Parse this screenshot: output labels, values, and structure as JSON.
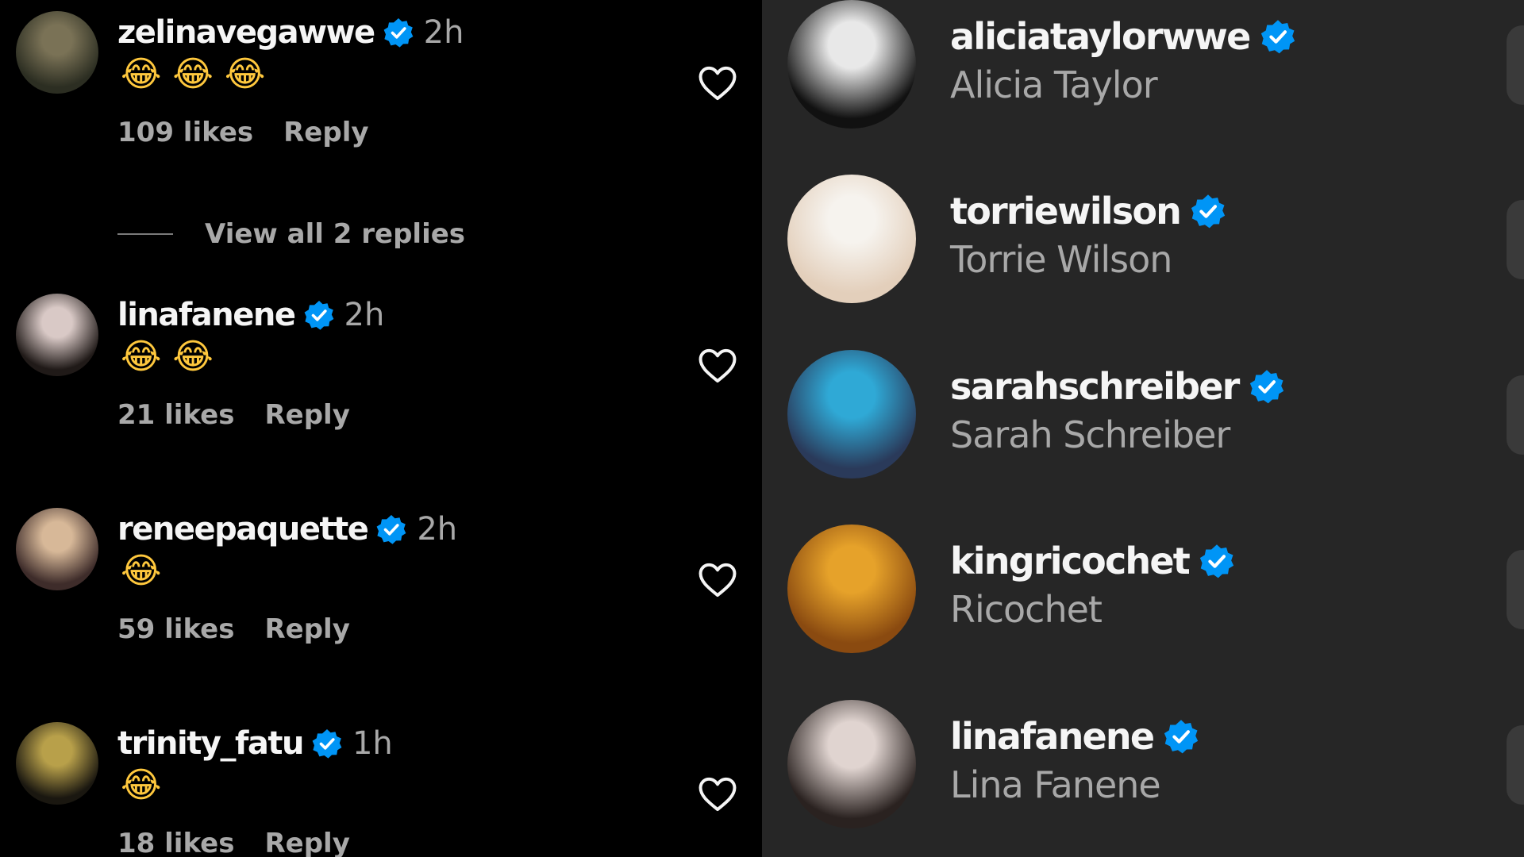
{
  "comments": [
    {
      "username": "zelinavegawwe",
      "time": "2h",
      "emojis": [
        "😂",
        "😂",
        "😂"
      ],
      "likes": "109 likes",
      "reply": "Reply",
      "avatar_colors": [
        "#2c2e22",
        "#7a7256"
      ]
    },
    {
      "username": "linafanene",
      "time": "2h",
      "emojis": [
        "😂",
        "😂"
      ],
      "likes": "21 likes",
      "reply": "Reply",
      "avatar_colors": [
        "#201a18",
        "#d9c9c6"
      ]
    },
    {
      "username": "reneepaquette",
      "time": "2h",
      "emojis": [
        "😂"
      ],
      "likes": "59 likes",
      "reply": "Reply",
      "avatar_colors": [
        "#3e2c2a",
        "#d7b898"
      ]
    },
    {
      "username": "trinity_fatu",
      "time": "1h",
      "emojis": [
        "😂"
      ],
      "likes": "18 likes",
      "reply": "Reply",
      "avatar_colors": [
        "#1a1710",
        "#b8a04a"
      ]
    }
  ],
  "view_replies": "View all 2 replies",
  "icons": {
    "verified": "verified-badge-icon",
    "heart": "heart-outline-icon"
  },
  "colors": {
    "verified_blue": "#0095f6",
    "left_bg": "#000000",
    "right_bg": "#262626",
    "muted_text": "#a8a8a8",
    "emoji_yellow": "#ffc83d"
  },
  "accounts": [
    {
      "username": "aliciataylorwwe",
      "name": "Alicia Taylor",
      "avatar_colors": [
        "#111111",
        "#e8e8e8"
      ]
    },
    {
      "username": "torriewilson",
      "name": "Torrie Wilson",
      "avatar_colors": [
        "#e3cfbb",
        "#f6f3ee"
      ]
    },
    {
      "username": "sarahschreiber",
      "name": "Sarah Schreiber",
      "avatar_colors": [
        "#2a3a5a",
        "#2fa9d6"
      ]
    },
    {
      "username": "kingricochet",
      "name": "Ricochet",
      "avatar_colors": [
        "#8a4a10",
        "#e6a22a"
      ]
    },
    {
      "username": "linafanene",
      "name": "Lina Fanene",
      "avatar_colors": [
        "#2a2220",
        "#e0d4d0"
      ]
    }
  ]
}
